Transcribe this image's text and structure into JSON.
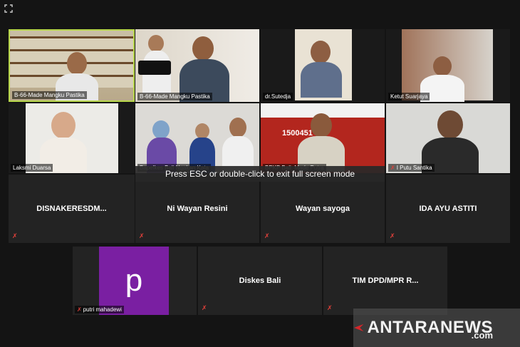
{
  "window": {
    "fullscreen_hint": "Press ESC or double-click to exit full screen mode"
  },
  "participants": [
    {
      "name": "B-66-Made Mangku Pastika",
      "video": true,
      "active": true
    },
    {
      "name": "B-66-Made Mangku Pastika",
      "video": true
    },
    {
      "name": "dr.Sutedja",
      "video": true
    },
    {
      "name": "Ketut Suarjaya",
      "video": true
    },
    {
      "name": "Laksmi Duarsa",
      "video": true
    },
    {
      "name": "Bapelkes Bali Ngakan Kata",
      "video": true
    },
    {
      "name": "BPKP Bali_Made Putra",
      "video": true
    },
    {
      "name": "I Putu Santika",
      "video": true
    },
    {
      "name": "DISNAKERESDM...",
      "video": false
    },
    {
      "name": "Ni Wayan Resini",
      "video": false
    },
    {
      "name": "Wayan sayoga",
      "video": false
    },
    {
      "name": "IDA AYU ASTITI",
      "video": false
    },
    {
      "name": "putri mahadewi",
      "video": false,
      "avatar_letter": "p"
    },
    {
      "name": "Diskes Bali",
      "video": false
    },
    {
      "name": "TIM DPD/MPR R...",
      "video": false
    }
  ],
  "slide_text": {
    "hotline": "1500451"
  },
  "watermark": {
    "brand": "ANTARANEWS",
    "suffix": ".com"
  },
  "colors": {
    "active_border": "#b7d64a",
    "mute": "#e0403a",
    "avatar": "#7a1fa2"
  }
}
